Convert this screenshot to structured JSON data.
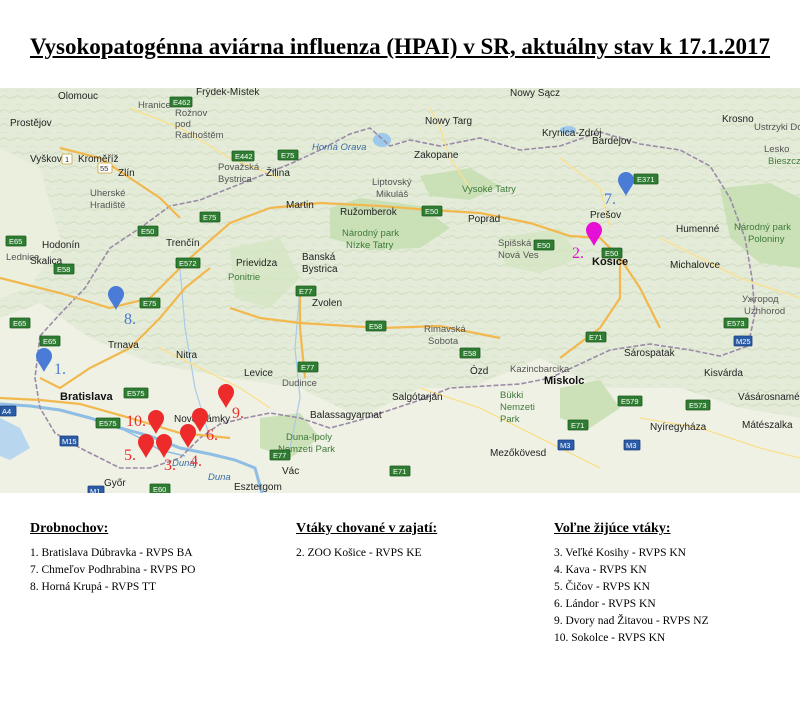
{
  "title": "Vysokopatogénna aviárna influenza (HPAI) v SR, aktuálny stav k 17.1.2017",
  "map": {
    "labels": {
      "olomouc": "Olomouc",
      "prostejov": "Prostějov",
      "vyskov": "Vyškov",
      "kromeriz": "Kroměříž",
      "zlin": "Zlín",
      "uherske": "Uherské",
      "hradiste": "Hradiště",
      "hodonin": "Hodonín",
      "skalica": "Skalica",
      "lednice": "Lednice",
      "hranice": "Hranice",
      "roznov": "Rožnov",
      "roznov2": "pod",
      "roznov3": "Radhoštěm",
      "frydek": "Frýdek-Místek",
      "povazska": "Považská",
      "bystrica": "Bystrica",
      "zilina": "Žilina",
      "horna_orava": "Horná Orava",
      "trencin": "Trenčín",
      "martin": "Martin",
      "ruzomberok": "Ružomberok",
      "liptovsky": "Liptovský",
      "mikulas": "Mikuláš",
      "zakopane": "Zakopane",
      "nowy_targ": "Nowy Targ",
      "nowy_sacz": "Nowy Sącz",
      "krynica": "Krynica-Zdrój",
      "vysoke_tatry": "Vysoké Tatry",
      "poprad": "Poprad",
      "bardejov": "Bardejov",
      "presov": "Prešov",
      "humenne": "Humenné",
      "krosno": "Krosno",
      "ustrzyki": "Ustrzyki Doln",
      "lesko": "Lesko",
      "bieszcz": "Bieszcza",
      "nizke_tatry": "Národný park",
      "nizke_tatry2": "Nízke Tatry",
      "poloniny": "Národný park",
      "poloniny2": "Poloniny",
      "spisska": "Spišská",
      "nova_ves": "Nová Ves",
      "kosice": "Košice",
      "michalovce": "Michalovce",
      "uzhgorod": "Ужгород",
      "uzhhorod": "Uzhhorod",
      "prievidza": "Prievidza",
      "banska": "Banská",
      "bystrica2": "Bystrica",
      "ponitrie": "Ponitrie",
      "zvolen": "Zvolen",
      "trnava": "Trnava",
      "nitra": "Nitra",
      "rimavska": "Rimavská",
      "sobota": "Sobota",
      "bratislava": "Bratislava",
      "levice": "Levice",
      "dudince": "Dudince",
      "nove_zamky": "Nové Zámky",
      "salgotarjan": "Salgótarján",
      "balassagyarmat": "Balassagyarmat",
      "ozd": "Ózd",
      "kazincbarcika": "Kazincbarcika",
      "sarospatak": "Sárospatak",
      "miskolc": "Miskolc",
      "bukki": "Bükki",
      "nemzeti": "Nemzeti",
      "park": "Park",
      "kisvarda": "Kisvárda",
      "vasarosnameny": "Vásárosnamény",
      "nyiregyhaza": "Nyíregyháza",
      "mateszalka": "Mátészalka",
      "duna_ipoly": "Duna-Ipoly",
      "duna_ipoly2": "Nemzeti Park",
      "vac": "Vác",
      "mezokovesd": "Mezőkövesd",
      "esztergom": "Esztergom",
      "gyor": "Győr",
      "dunaj": "Dunaj",
      "duna": "Duna"
    },
    "roads": {
      "e462": "E462",
      "e442": "E442",
      "e75a": "E75",
      "e50a": "E50",
      "e65a": "E65",
      "e75b": "E75",
      "e50b": "E50",
      "e58a": "E58",
      "e572": "E572",
      "e77a": "E77",
      "e58b": "E58",
      "e71a": "E71",
      "e371": "E371",
      "e50c": "E50",
      "e50d": "E50",
      "e573": "E573",
      "m25": "M25",
      "e575": "E575",
      "m15": "M15",
      "m1": "M1",
      "m3": "M3",
      "m3b": "M3",
      "e71b": "E71",
      "e77b": "E77",
      "e60": "E60",
      "e579": "E579",
      "e573b": "E573",
      "e58c": "E58",
      "e65b": "E65",
      "e75c": "E75",
      "e71c": "E71",
      "a4": "A4",
      "d1": "1",
      "s5": "55",
      "e77c": "E77",
      "e575b": "E575",
      "r1": "E65"
    },
    "markers": [
      {
        "id": "1",
        "label": "1.",
        "color": "#4a7bd6"
      },
      {
        "id": "7",
        "label": "7.",
        "color": "#4a7bd6"
      },
      {
        "id": "8",
        "label": "8.",
        "color": "#4a7bd6"
      },
      {
        "id": "2",
        "label": "2.",
        "color": "#e60fd6"
      },
      {
        "id": "3",
        "label": "3.",
        "color": "#ee2b2b"
      },
      {
        "id": "4",
        "label": "4.",
        "color": "#ee2b2b"
      },
      {
        "id": "5",
        "label": "5.",
        "color": "#ee2b2b"
      },
      {
        "id": "6",
        "label": "6.",
        "color": "#ee2b2b"
      },
      {
        "id": "9",
        "label": "9.",
        "color": "#ee2b2b"
      },
      {
        "id": "10",
        "label": "10.",
        "color": "#ee2b2b"
      }
    ]
  },
  "legend": {
    "drobnochov": {
      "heading": "Drobnochov:",
      "items": [
        "1. Bratislava Dúbravka - RVPS BA",
        "7. Chmeľov Podhrabina - RVPS PO",
        "8. Horná Krupá - RVPS TT"
      ]
    },
    "zajatie": {
      "heading": "Vtáky chované v zajatí:",
      "items": [
        "2. ZOO Košice - RVPS KE"
      ]
    },
    "volne": {
      "heading": "Voľne žijúce vtáky:",
      "items": [
        "3. Veľké Kosihy - RVPS KN",
        "4. Kava - RVPS KN",
        "5. Čičov - RVPS KN",
        "6. Lándor - RVPS KN",
        "9. Dvory nad Žitavou - RVPS NZ",
        "10. Sokolce - RVPS KN"
      ]
    }
  }
}
